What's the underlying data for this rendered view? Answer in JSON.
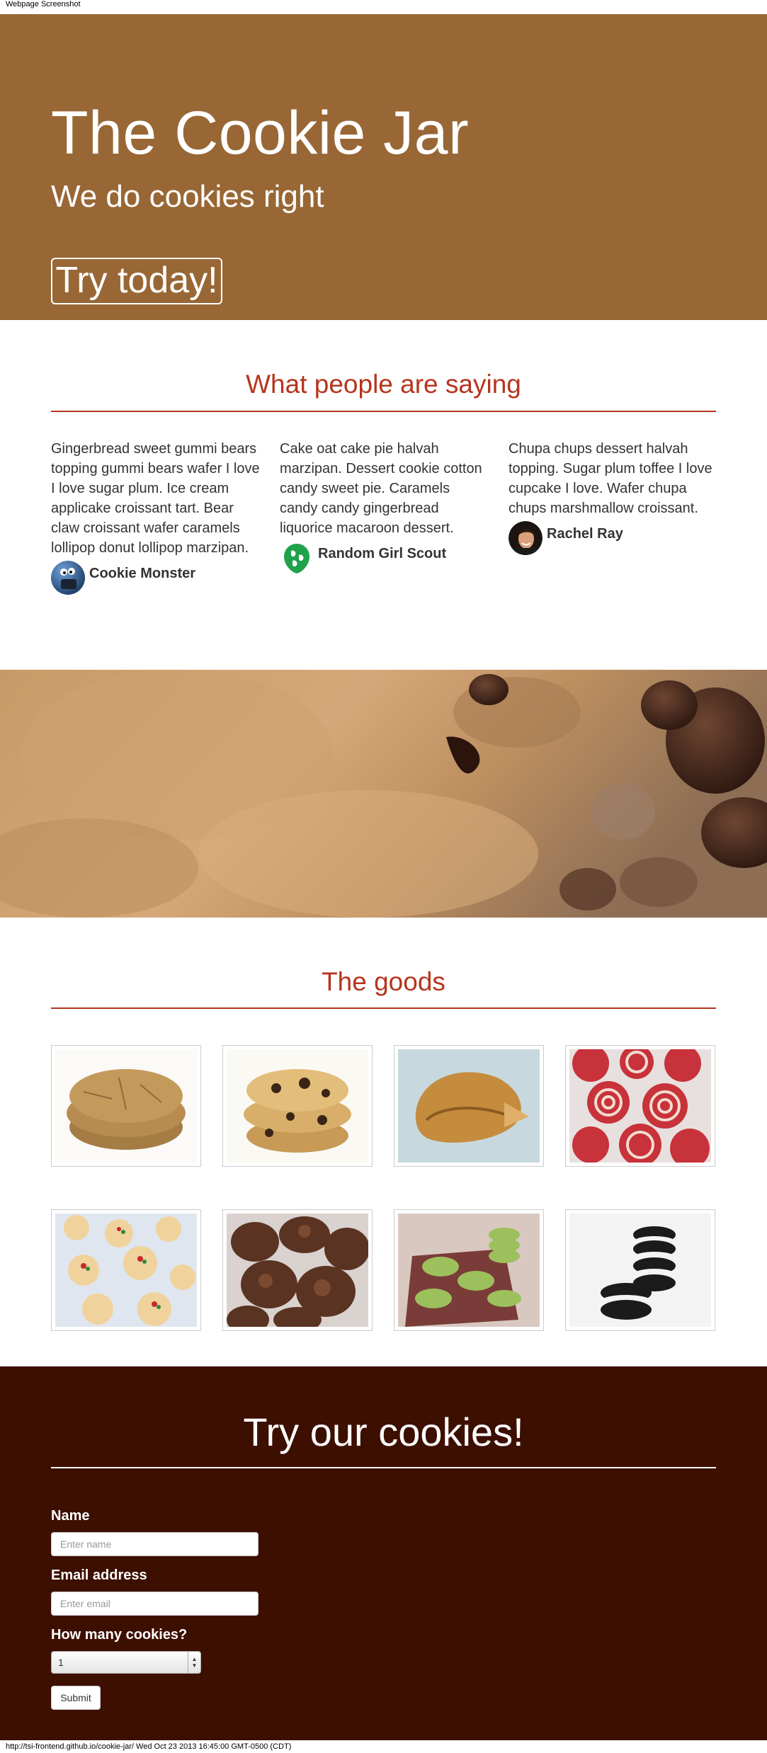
{
  "capture": {
    "top_label": "Webpage Screenshot",
    "bottom_label": "http://tsi-frontend.github.io/cookie-jar/ Wed Oct 23 2013 16:45:00 GMT-0500 (CDT)"
  },
  "hero": {
    "title": "The Cookie Jar",
    "subtitle": "We do cookies right",
    "cta_label": "Try today!",
    "background": "#986735"
  },
  "testimonials": {
    "title": "What people are saying",
    "accent": "#b5351e",
    "items": [
      {
        "quote": "Gingerbread sweet gummi bears topping gummi bears wafer I love I love sugar plum. Ice cream applicake croissant tart. Bear claw croissant wafer caramels lollipop donut lollipop marzipan.",
        "author": "Cookie Monster",
        "avatar_icon": "cookie-monster-avatar-icon"
      },
      {
        "quote": "Cake oat cake pie halvah marzipan. Dessert cookie cotton candy sweet pie. Caramels candy candy gingerbread liquorice macaroon dessert.",
        "author": "Random Girl Scout",
        "avatar_icon": "girl-scout-trefoil-icon"
      },
      {
        "quote": "Chupa chups dessert halvah topping. Sugar plum toffee I love cupcake I love. Wafer chupa chups marshmallow croissant.",
        "author": "Rachel Ray",
        "avatar_icon": "rachel-ray-avatar-icon"
      }
    ]
  },
  "banner": {
    "image": "cookie-closeup-banner"
  },
  "goods": {
    "title": "The goods",
    "items": [
      "ginger-snap-cookies-photo",
      "chocolate-chip-cookies-photo",
      "fortune-cookie-photo",
      "pinwheel-cookies-photo",
      "spritz-cookies-photo",
      "double-chocolate-cookies-photo",
      "matcha-cookies-photo",
      "oreo-cookies-photo"
    ]
  },
  "order_form": {
    "title": "Try our cookies!",
    "background": "#3d0f01",
    "name_label": "Name",
    "name_placeholder": "Enter name",
    "email_label": "Email address",
    "email_placeholder": "Enter email",
    "count_label": "How many cookies?",
    "count_value": "1",
    "submit_label": "Submit"
  }
}
